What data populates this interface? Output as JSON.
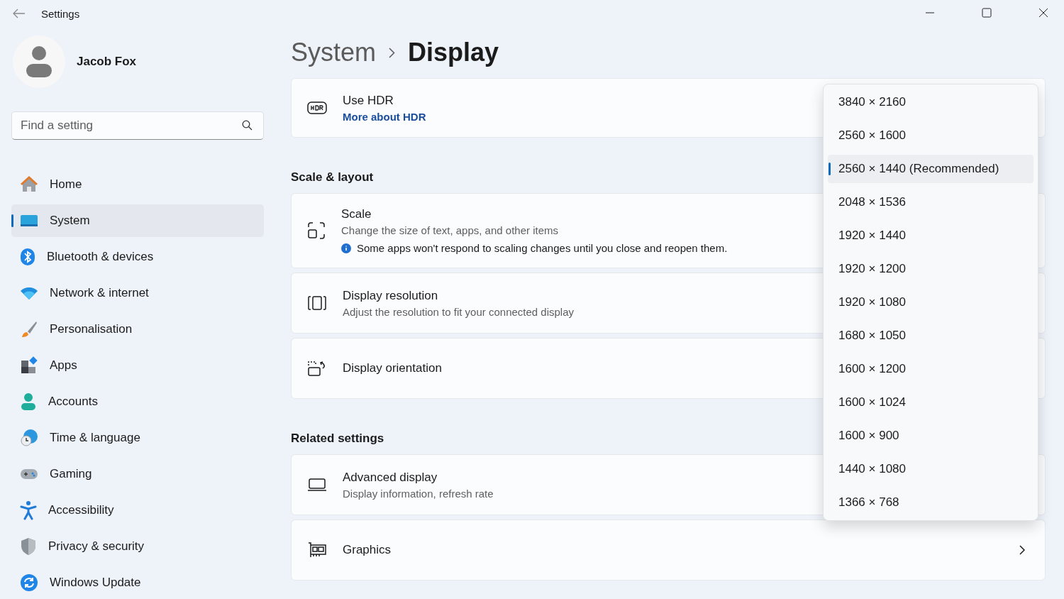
{
  "window": {
    "title": "Settings"
  },
  "account": {
    "name": "Jacob Fox"
  },
  "search": {
    "placeholder": "Find a setting"
  },
  "sidebar": {
    "items": [
      {
        "label": "Home",
        "selected": false
      },
      {
        "label": "System",
        "selected": true
      },
      {
        "label": "Bluetooth & devices",
        "selected": false
      },
      {
        "label": "Network & internet",
        "selected": false
      },
      {
        "label": "Personalisation",
        "selected": false
      },
      {
        "label": "Apps",
        "selected": false
      },
      {
        "label": "Accounts",
        "selected": false
      },
      {
        "label": "Time & language",
        "selected": false
      },
      {
        "label": "Gaming",
        "selected": false
      },
      {
        "label": "Accessibility",
        "selected": false
      },
      {
        "label": "Privacy & security",
        "selected": false
      },
      {
        "label": "Windows Update",
        "selected": false
      }
    ]
  },
  "breadcrumb": [
    "System",
    "Display"
  ],
  "content": [
    {
      "kind": "card",
      "title": "Use HDR",
      "link": "More about HDR"
    },
    {
      "kind": "heading",
      "text": "Scale & layout"
    },
    {
      "kind": "card",
      "title": "Scale",
      "description": "Change the size of text, apps, and other items",
      "note": "Some apps won't respond to scaling changes until you close and reopen them."
    },
    {
      "kind": "card",
      "title": "Display resolution",
      "description": "Adjust the resolution to fit your connected display"
    },
    {
      "kind": "card",
      "title": "Display orientation"
    },
    {
      "kind": "heading",
      "text": "Related settings"
    },
    {
      "kind": "card",
      "title": "Advanced display",
      "description": "Display information, refresh rate"
    },
    {
      "kind": "card",
      "title": "Graphics",
      "chevron": true
    }
  ],
  "dropdown": {
    "options": [
      {
        "label": "3840 × 2160",
        "selected": false
      },
      {
        "label": "2560 × 1600",
        "selected": false
      },
      {
        "label": "2560 × 1440 (Recommended)",
        "selected": true
      },
      {
        "label": "2048 × 1536",
        "selected": false
      },
      {
        "label": "1920 × 1440",
        "selected": false
      },
      {
        "label": "1920 × 1200",
        "selected": false
      },
      {
        "label": "1920 × 1080",
        "selected": false
      },
      {
        "label": "1680 × 1050",
        "selected": false
      },
      {
        "label": "1600 × 1200",
        "selected": false
      },
      {
        "label": "1600 × 1024",
        "selected": false
      },
      {
        "label": "1600 × 900",
        "selected": false
      },
      {
        "label": "1440 × 1080",
        "selected": false
      },
      {
        "label": "1366 × 768",
        "selected": false
      }
    ]
  }
}
